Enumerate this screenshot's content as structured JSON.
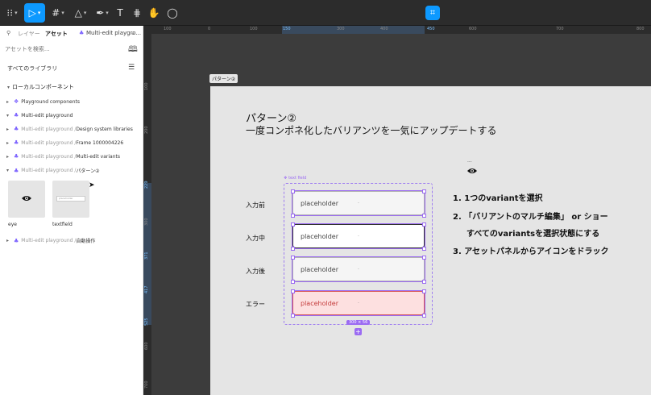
{
  "toolbar": {
    "tools": [
      {
        "name": "main-menu",
        "glyph": "⁝⁝"
      },
      {
        "name": "move",
        "glyph": "▷"
      },
      {
        "name": "frame",
        "glyph": "#"
      },
      {
        "name": "shape",
        "glyph": "△"
      },
      {
        "name": "pen",
        "glyph": "✒"
      },
      {
        "name": "text",
        "glyph": "T"
      },
      {
        "name": "resources",
        "glyph": "⋕"
      },
      {
        "name": "hand",
        "glyph": "✋"
      },
      {
        "name": "comment",
        "glyph": "◯"
      }
    ]
  },
  "left_panel": {
    "tab_layers": "レイヤー",
    "tab_assets": "アセット",
    "file_name": "Multi-edit playgro...",
    "search_placeholder": "アセットを検索...",
    "library_filter": "すべてのライブラリ",
    "section_title": "ローカルコンポーネント",
    "tree": [
      {
        "dim": "",
        "text": "Playground components"
      },
      {
        "dim": "",
        "text": "Multi-edit playground"
      },
      {
        "dim": "Multi-edit playground / ",
        "text": "Design system libraries"
      },
      {
        "dim": "Multi-edit playground / ",
        "text": "Frame 1000004226"
      },
      {
        "dim": "Multi-edit playground / ",
        "text": "Multi-edit variants"
      },
      {
        "dim": "Multi-edit playground / ",
        "text": "パターン②"
      },
      {
        "dim": "Multi-edit playground / ",
        "text": "自動操作"
      }
    ],
    "thumb_eye_label": "eye",
    "thumb_textfield_label": "textfield",
    "thumb_textfield_preview": "placeholder"
  },
  "rulers": {
    "top": [
      "100",
      "0",
      "100",
      "150",
      "300",
      "400",
      "450",
      "600",
      "700",
      "800"
    ],
    "top_highlight": [
      "150",
      "450"
    ],
    "left": [
      "100",
      "200",
      "229",
      "300",
      "371",
      "417",
      "525",
      "600",
      "700"
    ],
    "left_highlight": [
      "229",
      "371",
      "417",
      "525"
    ]
  },
  "canvas": {
    "frame_tag": "パターン②",
    "title_line1": "パターン②",
    "title_line2": "一度コンポネ化したバリアンツを一気にアップデートする",
    "component_tag": "❖ text field",
    "size_badge": "300 × 56",
    "ellipsis": "...",
    "states": [
      {
        "label": "入力前",
        "placeholder": "placeholder",
        "variant": "default"
      },
      {
        "label": "入力中",
        "placeholder": "placeholder",
        "variant": "focused"
      },
      {
        "label": "入力後",
        "placeholder": "placeholder",
        "variant": "default"
      },
      {
        "label": "エラー",
        "placeholder": "placeholder",
        "variant": "error"
      }
    ],
    "steps": {
      "s1": "1. 1つのvariantを選択",
      "s2a": "2. 「バリアントのマルチ編集」 or ショー",
      "s2b": "すべてのvariantsを選択状態にする",
      "s3": "3. アセットパネルからアイコンをドラック"
    }
  },
  "colors": {
    "accent": "#0d99ff",
    "component_purple": "#9b6bf2",
    "error_fill": "#fde0e0",
    "error_border": "#d8585a"
  }
}
